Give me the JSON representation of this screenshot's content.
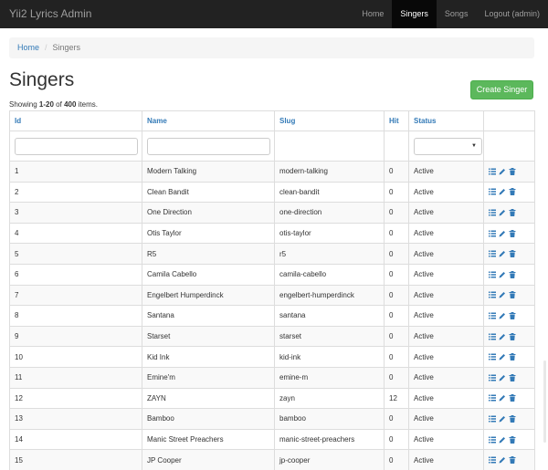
{
  "brand": "Yii2 Lyrics Admin",
  "nav": [
    {
      "label": "Home",
      "active": false
    },
    {
      "label": "Singers",
      "active": true
    },
    {
      "label": "Songs",
      "active": false
    },
    {
      "label": "Logout (admin)",
      "active": false
    }
  ],
  "breadcrumb": {
    "home": "Home",
    "separator": "/",
    "current": "Singers"
  },
  "page_title": "Singers",
  "create_button": "Create Singer",
  "summary": {
    "prefix": "Showing ",
    "range": "1-20",
    "of": " of ",
    "total": "400",
    "suffix": " items."
  },
  "columns": [
    "Id",
    "Name",
    "Slug",
    "Hit",
    "Status"
  ],
  "rows": [
    {
      "id": "1",
      "name": "Modern Talking",
      "slug": "modern-talking",
      "hit": "0",
      "status": "Active"
    },
    {
      "id": "2",
      "name": "Clean Bandit",
      "slug": "clean-bandit",
      "hit": "0",
      "status": "Active"
    },
    {
      "id": "3",
      "name": "One Direction",
      "slug": "one-direction",
      "hit": "0",
      "status": "Active"
    },
    {
      "id": "4",
      "name": "Otis Taylor",
      "slug": "otis-taylor",
      "hit": "0",
      "status": "Active"
    },
    {
      "id": "5",
      "name": "R5",
      "slug": "r5",
      "hit": "0",
      "status": "Active"
    },
    {
      "id": "6",
      "name": "Camila Cabello",
      "slug": "camila-cabello",
      "hit": "0",
      "status": "Active"
    },
    {
      "id": "7",
      "name": "Engelbert Humperdinck",
      "slug": "engelbert-humperdinck",
      "hit": "0",
      "status": "Active"
    },
    {
      "id": "8",
      "name": "Santana",
      "slug": "santana",
      "hit": "0",
      "status": "Active"
    },
    {
      "id": "9",
      "name": "Starset",
      "slug": "starset",
      "hit": "0",
      "status": "Active"
    },
    {
      "id": "10",
      "name": "Kid Ink",
      "slug": "kid-ink",
      "hit": "0",
      "status": "Active"
    },
    {
      "id": "11",
      "name": "Emine'm",
      "slug": "emine-m",
      "hit": "0",
      "status": "Active"
    },
    {
      "id": "12",
      "name": "ZAYN",
      "slug": "zayn",
      "hit": "12",
      "status": "Active"
    },
    {
      "id": "13",
      "name": "Bamboo",
      "slug": "bamboo",
      "hit": "0",
      "status": "Active"
    },
    {
      "id": "14",
      "name": "Manic Street Preachers",
      "slug": "manic-street-preachers",
      "hit": "0",
      "status": "Active"
    },
    {
      "id": "15",
      "name": "JP Cooper",
      "slug": "jp-cooper",
      "hit": "0",
      "status": "Active"
    }
  ],
  "colors": {
    "navbar": "#222222",
    "link": "#337ab7",
    "success": "#5cb85c"
  },
  "action_icons": [
    "list-icon",
    "pencil-icon",
    "trash-icon"
  ]
}
